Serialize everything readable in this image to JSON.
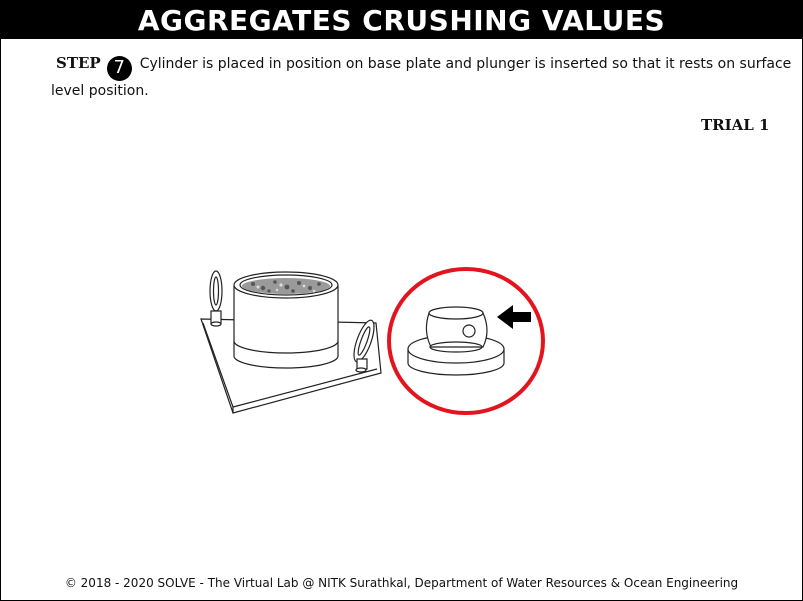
{
  "header": {
    "title": "AGGREGATES CRUSHING VALUES"
  },
  "step": {
    "label": "STEP",
    "number": "7",
    "instruction": "Cylinder is placed in position on base plate and plunger is inserted so that it rests on surface level position."
  },
  "trial": {
    "label": "TRIAL 1"
  },
  "footer": {
    "text": "© 2018 - 2020 SOLVE - The Virtual Lab @ NITK Surathkal, Department of Water Resources & Ocean Engineering"
  },
  "colors": {
    "highlight_ring": "#e3141d",
    "title_bg": "#000000"
  }
}
